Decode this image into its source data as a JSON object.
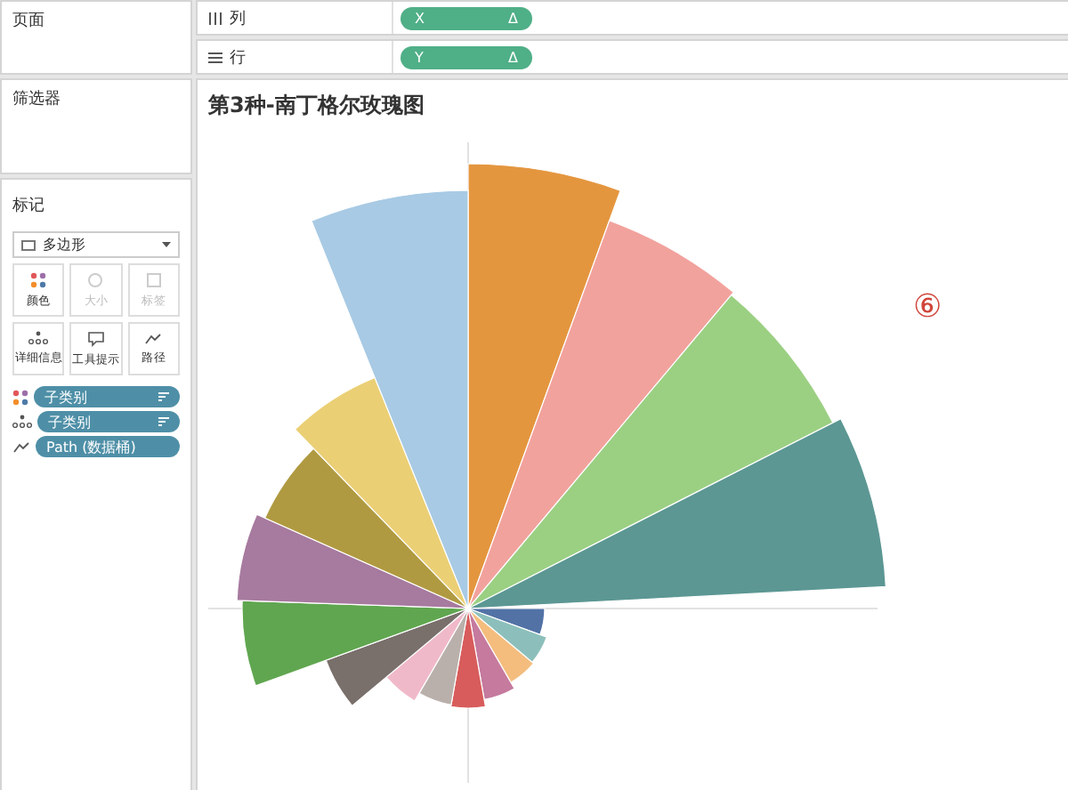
{
  "pages_panel": {
    "title": "页面"
  },
  "shelves": [
    {
      "kind": "columns",
      "label": "列",
      "pill": "X",
      "pill_mark": "Δ"
    },
    {
      "kind": "rows",
      "label": "行",
      "pill": "Y",
      "pill_mark": "Δ"
    }
  ],
  "filters_panel": {
    "title": "筛选器"
  },
  "marks_panel": {
    "title": "标记",
    "mark_type": "多边形",
    "buttons": [
      {
        "kind": "color",
        "label": "颜色",
        "disabled": false
      },
      {
        "kind": "size",
        "label": "大小",
        "disabled": true
      },
      {
        "kind": "label",
        "label": "标签",
        "disabled": true
      },
      {
        "kind": "detail",
        "label": "详细信息",
        "disabled": false
      },
      {
        "kind": "tooltip",
        "label": "工具提示",
        "disabled": false
      },
      {
        "kind": "path",
        "label": "路径",
        "disabled": false
      }
    ],
    "fields": [
      {
        "kind": "color",
        "label": "子类别",
        "sorted": true
      },
      {
        "kind": "detail",
        "label": "子类别",
        "sorted": true
      },
      {
        "kind": "path",
        "label": "Path (数据桶)",
        "sorted": false
      }
    ]
  },
  "view": {
    "title": "第3种-南丁格尔玫瑰图",
    "annotation": "⑥"
  }
}
